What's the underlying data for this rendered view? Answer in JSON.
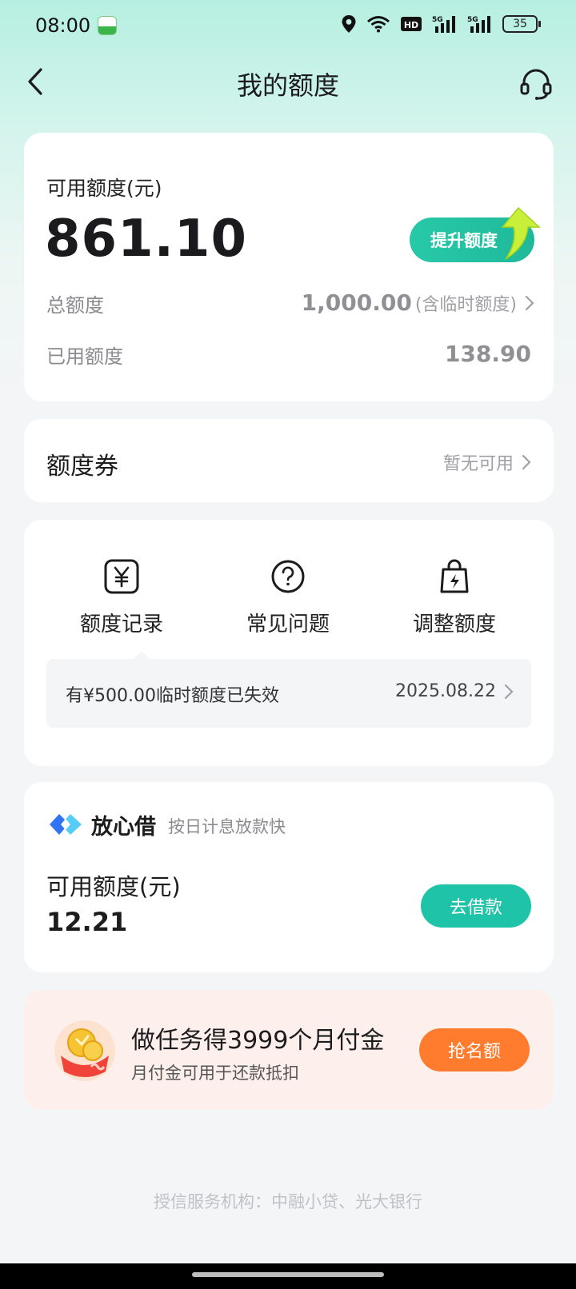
{
  "status_bar": {
    "time": "08:00",
    "network_1": "5G",
    "network_2": "5G",
    "hd_label": "HD",
    "battery": "35"
  },
  "header": {
    "title": "我的额度",
    "back_icon": "chevron-left-icon",
    "support_icon": "headset-icon"
  },
  "credit": {
    "available_label": "可用额度(元)",
    "available_amount": "861.10",
    "raise_button": "提升额度",
    "total_label": "总额度",
    "total_amount": "1,000.00",
    "total_note": "(含临时额度)",
    "used_label": "已用额度",
    "used_amount": "138.90"
  },
  "coupon": {
    "title": "额度券",
    "status": "暂无可用"
  },
  "actions": {
    "items": [
      {
        "label": "额度记录",
        "icon": "yuan-receipt-icon"
      },
      {
        "label": "常见问题",
        "icon": "question-circle-icon"
      },
      {
        "label": "调整额度",
        "icon": "lightning-bag-icon"
      }
    ],
    "notice_text": "有¥500.00临时额度已失效",
    "notice_date": "2025.08.22"
  },
  "loan": {
    "brand": "放心借",
    "subtitle": "按日计息放款快",
    "available_label": "可用额度(元)",
    "available_amount": "12.21",
    "button": "去借款"
  },
  "promo": {
    "title": "做任务得3999个月付金",
    "subtitle": "月付金可用于还款抵扣",
    "button": "抢名额"
  },
  "footer": {
    "note": "授信服务机构：中融小贷、光大银行"
  },
  "colors": {
    "accent_teal": "#1fc3a7",
    "promo_orange": "#ff7b2e",
    "header_gradient_top": "#b6efe1"
  }
}
